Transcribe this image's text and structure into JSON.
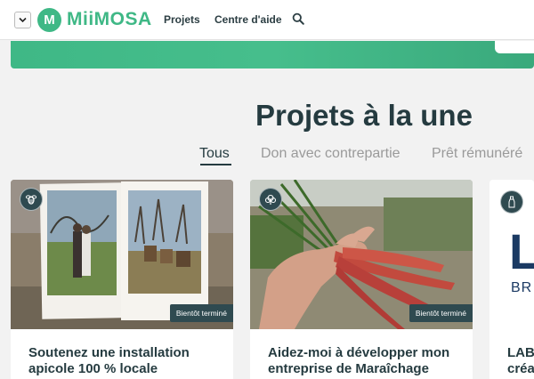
{
  "header": {
    "logo_letter": "M",
    "logo_text": "MiiMOSA",
    "nav": [
      {
        "label": "Projets"
      },
      {
        "label": "Centre d'aide"
      }
    ]
  },
  "section": {
    "title": "Projets à la une"
  },
  "tabs": [
    {
      "label": "Tous",
      "active": true
    },
    {
      "label": "Don avec contrepartie",
      "active": false
    },
    {
      "label": "Prêt rémunéré",
      "active": false
    }
  ],
  "cards": [
    {
      "title": "Soutenez une installation apicole 100 % locale",
      "status": "Bientôt terminé",
      "category_icon": "bee-icon"
    },
    {
      "title": "Aidez-moi à développer mon entreprise de Maraîchage",
      "status": "Bientôt terminé",
      "category_icon": "plant-icon"
    },
    {
      "title_line1": "LAB",
      "title_line2": "créa",
      "image_letter": "L",
      "image_sub": "BR",
      "category_icon": "bottle-icon"
    }
  ],
  "colors": {
    "brand_green": "#3fb886",
    "dark_teal": "#2f4a50",
    "title_text": "#253b40",
    "muted_tab": "#9a9a9a"
  }
}
